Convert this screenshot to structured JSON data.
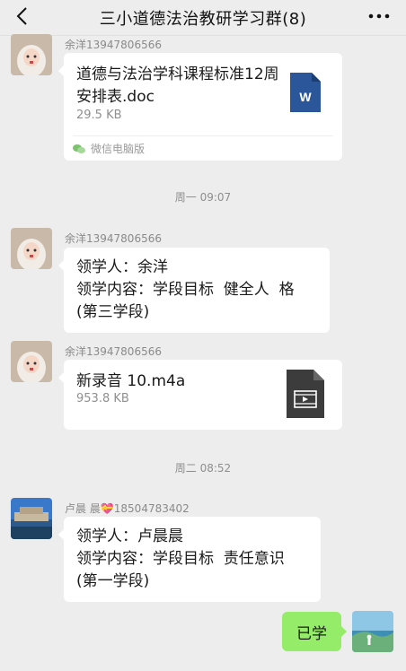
{
  "header": {
    "title": "三小道德法治教研学习群(8)",
    "back_icon": "chevron-left-icon",
    "more_icon": "more-dots-icon"
  },
  "messages": [
    {
      "type": "file",
      "sender": "余洋13947806566",
      "file_name": "道德与法治学科课程标准12周安排表.doc",
      "file_size": "29.5 KB",
      "file_icon": "word-doc-icon",
      "source": "微信电脑版"
    },
    {
      "type": "time",
      "time": "周一 09:07"
    },
    {
      "type": "text",
      "sender": "余洋13947806566",
      "lines": [
        "领学人：余洋",
        "领学内容：学段目标  健全人  格",
        "(第三学段)"
      ]
    },
    {
      "type": "file",
      "sender": "余洋13947806566",
      "file_name": "新录音 10.m4a",
      "file_size": "953.8 KB",
      "file_icon": "video-file-icon"
    },
    {
      "type": "time",
      "time": "周二 08:52"
    },
    {
      "type": "text",
      "sender_name": "卢晨 晨",
      "sender_emoji": "💝",
      "sender_phone": "18504783402",
      "lines": [
        "领学人：卢晨晨",
        "领学内容：学段目标  责任意识",
        "(第一学段)"
      ]
    },
    {
      "type": "self",
      "text": "已学"
    }
  ],
  "colors": {
    "background": "#ededed",
    "bubble": "#ffffff",
    "self_bubble": "#95ec69",
    "word_blue": "#2b579a",
    "video_dark": "#3c3c3c"
  }
}
